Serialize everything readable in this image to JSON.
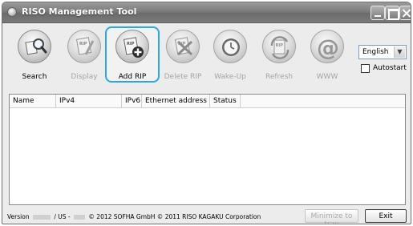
{
  "window": {
    "title": "RISO Management Tool"
  },
  "toolbar": {
    "buttons": [
      {
        "label": "Search",
        "icon": "search-icon",
        "enabled": true,
        "selected": false
      },
      {
        "label": "Display",
        "icon": "display-icon",
        "enabled": false,
        "selected": false
      },
      {
        "label": "Add RIP",
        "icon": "add-rip-icon",
        "enabled": true,
        "selected": true
      },
      {
        "label": "Delete RIP",
        "icon": "delete-rip-icon",
        "enabled": false,
        "selected": false
      },
      {
        "label": "Wake-Up",
        "icon": "clock-icon",
        "enabled": false,
        "selected": false
      },
      {
        "label": "Refresh",
        "icon": "refresh-icon",
        "enabled": false,
        "selected": false
      },
      {
        "label": "WWW",
        "icon": "at-icon",
        "enabled": false,
        "selected": false
      }
    ],
    "language": {
      "selected": "English"
    },
    "autostart": {
      "label": "Autostart",
      "checked": false
    }
  },
  "list": {
    "columns": [
      "Name",
      "IPv4",
      "IPv6",
      "Ethernet address",
      "Status"
    ],
    "rows": []
  },
  "footer": {
    "version_label": "Version",
    "us_label": "/ US -",
    "copyright": "© 2012 SOFHA GmbH © 2011 RISO KAGAKU Corporation",
    "minimize_label": "Minimize to tray",
    "exit_label": "Exit"
  },
  "colors": {
    "selection_border": "#2aa7e2",
    "title_bar": "#7c7c7c",
    "disabled_text": "#a5a5a5"
  }
}
